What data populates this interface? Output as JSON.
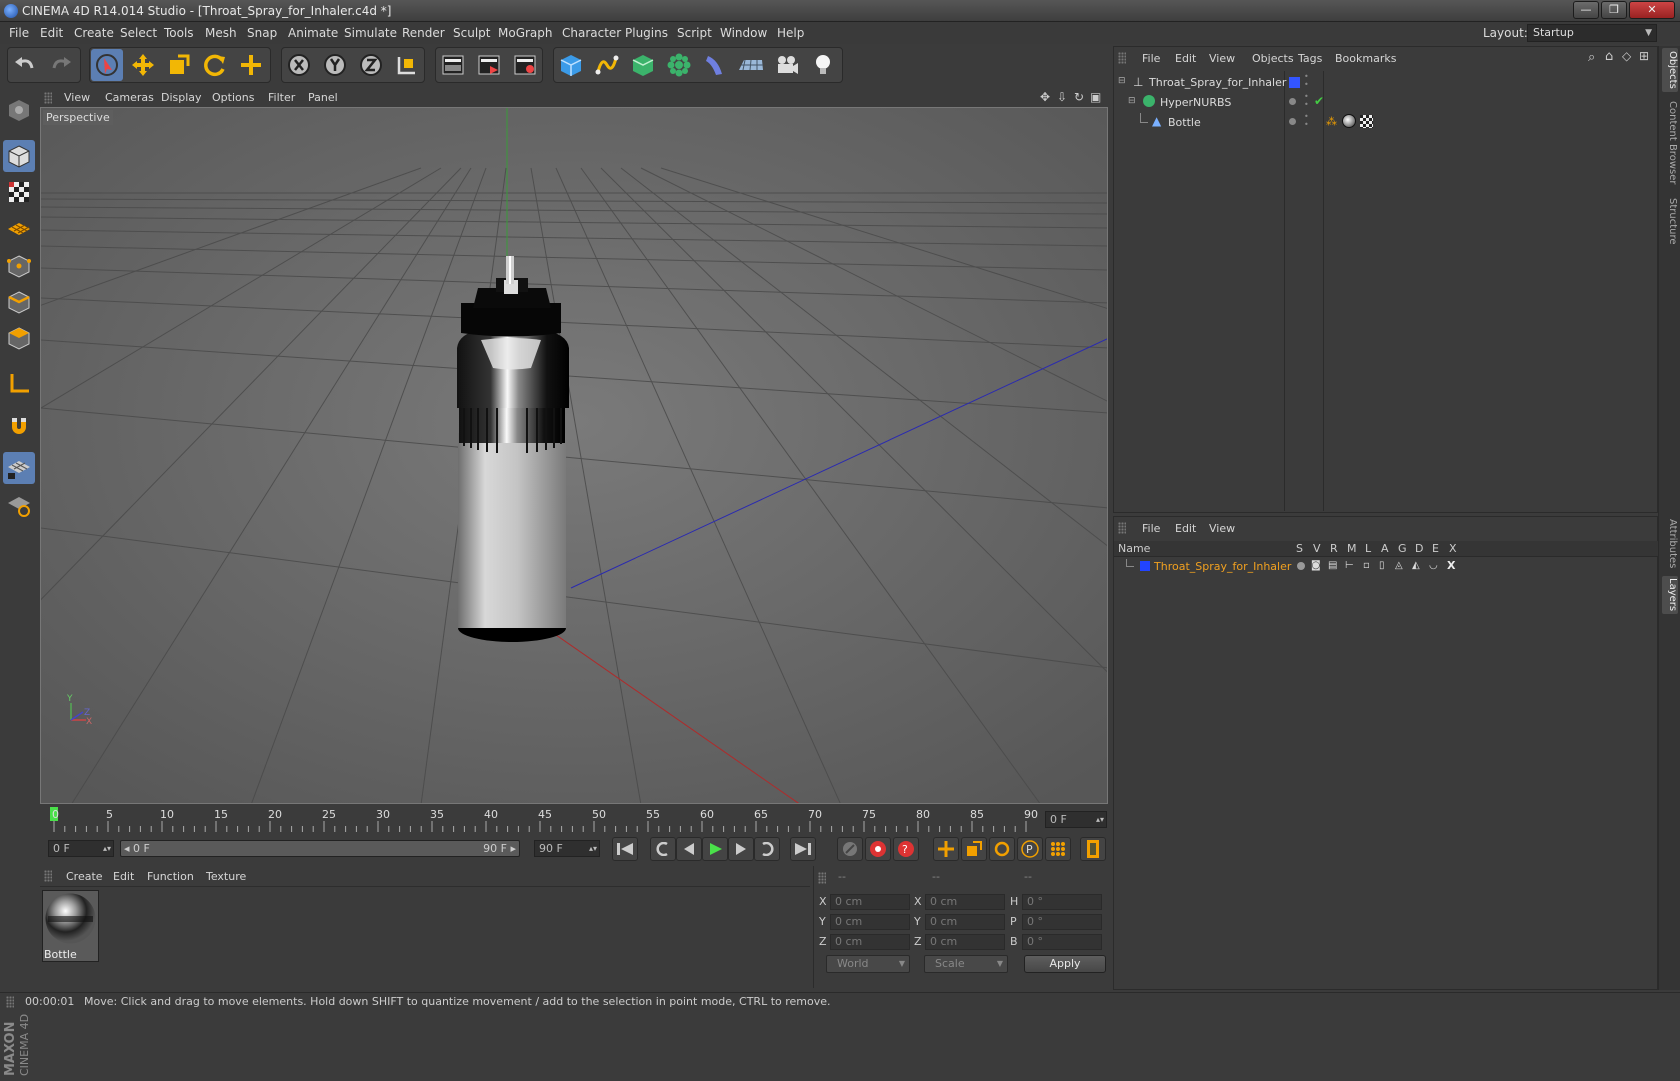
{
  "window": {
    "title": "CINEMA 4D R14.014 Studio - [Throat_Spray_for_Inhaler.c4d *]",
    "buttons": [
      "—",
      "❐",
      "✕"
    ]
  },
  "menubar": {
    "items": [
      "File",
      "Edit",
      "Create",
      "Select",
      "Tools",
      "Mesh",
      "Snap",
      "Animate",
      "Simulate",
      "Render",
      "Sculpt",
      "MoGraph",
      "Character",
      "Plugins",
      "Script",
      "Window",
      "Help"
    ],
    "layout_label": "Layout:",
    "layout_value": "Startup"
  },
  "toolbar": {
    "icons": [
      "undo-icon",
      "redo-icon",
      "live-selection-icon",
      "move-icon",
      "scale-icon",
      "rotate-icon",
      "last-tool-icon",
      "x-axis-icon",
      "y-axis-icon",
      "z-axis-icon",
      "coordinate-system-icon",
      "render-view-icon",
      "render-picture-viewer-icon",
      "render-settings-icon",
      "cube-icon",
      "spline-icon",
      "nurbs-icon",
      "array-icon",
      "deformer-icon",
      "floor-icon",
      "camera-icon",
      "light-icon"
    ]
  },
  "viewport": {
    "menu": [
      "View",
      "Cameras",
      "Display",
      "Options",
      "Filter",
      "Panel"
    ],
    "label": "Perspective",
    "axis_labels": {
      "y": "Y",
      "z": "Z",
      "x": "X"
    }
  },
  "timeline": {
    "ticks": [
      "0",
      "5",
      "10",
      "15",
      "20",
      "25",
      "30",
      "35",
      "40",
      "45",
      "50",
      "55",
      "60",
      "65",
      "70",
      "75",
      "80",
      "85",
      "90"
    ],
    "current_frame": "0 F",
    "playhead_frame": 0
  },
  "transport": {
    "start_field": "0 F",
    "range_start": "◂ 0 F",
    "range_end": "90 F ▸",
    "end_field": "90 F"
  },
  "materials": {
    "menu": [
      "Create",
      "Edit",
      "Function",
      "Texture"
    ],
    "items": [
      {
        "name": "Bottle"
      }
    ]
  },
  "coordinates": {
    "headers": [
      "--",
      "--",
      "--"
    ],
    "rows": [
      {
        "pos_label": "X",
        "pos": "0 cm",
        "size_label": "X",
        "size": "0 cm",
        "rot_label": "H",
        "rot": "0 °"
      },
      {
        "pos_label": "Y",
        "pos": "0 cm",
        "size_label": "Y",
        "size": "0 cm",
        "rot_label": "P",
        "rot": "0 °"
      },
      {
        "pos_label": "Z",
        "pos": "0 cm",
        "size_label": "Z",
        "size": "0 cm",
        "rot_label": "B",
        "rot": "0 °"
      }
    ],
    "mode": "World",
    "transform": "Scale",
    "apply": "Apply"
  },
  "status": {
    "time": "00:00:01",
    "message": "Move: Click and drag to move elements. Hold down SHIFT to quantize movement / add to the selection in point mode, CTRL to remove."
  },
  "object_manager": {
    "menu": [
      "File",
      "Edit",
      "View",
      "Objects",
      "Tags",
      "Bookmarks"
    ],
    "objects": [
      {
        "name": "Throat_Spray_for_Inhaler",
        "icon": "null-object-icon",
        "level": 0
      },
      {
        "name": "HyperNURBS",
        "icon": "hypernurbs-icon",
        "level": 1
      },
      {
        "name": "Bottle",
        "icon": "polygon-object-icon",
        "level": 2
      }
    ],
    "layer_color": "#3355ff"
  },
  "layer_manager": {
    "menu": [
      "File",
      "Edit",
      "View"
    ],
    "columns": [
      "Name",
      "S",
      "V",
      "R",
      "M",
      "L",
      "A",
      "G",
      "D",
      "E",
      "X"
    ],
    "layers": [
      {
        "name": "Throat_Spray_for_Inhaler",
        "color": "#2244ff",
        "text_color": "#f0a020"
      }
    ]
  },
  "right_tabs": [
    "Objects",
    "Content Browser",
    "Structure",
    "Attributes",
    "Layers"
  ],
  "maxon_logo": "MAXON CINEMA 4D"
}
